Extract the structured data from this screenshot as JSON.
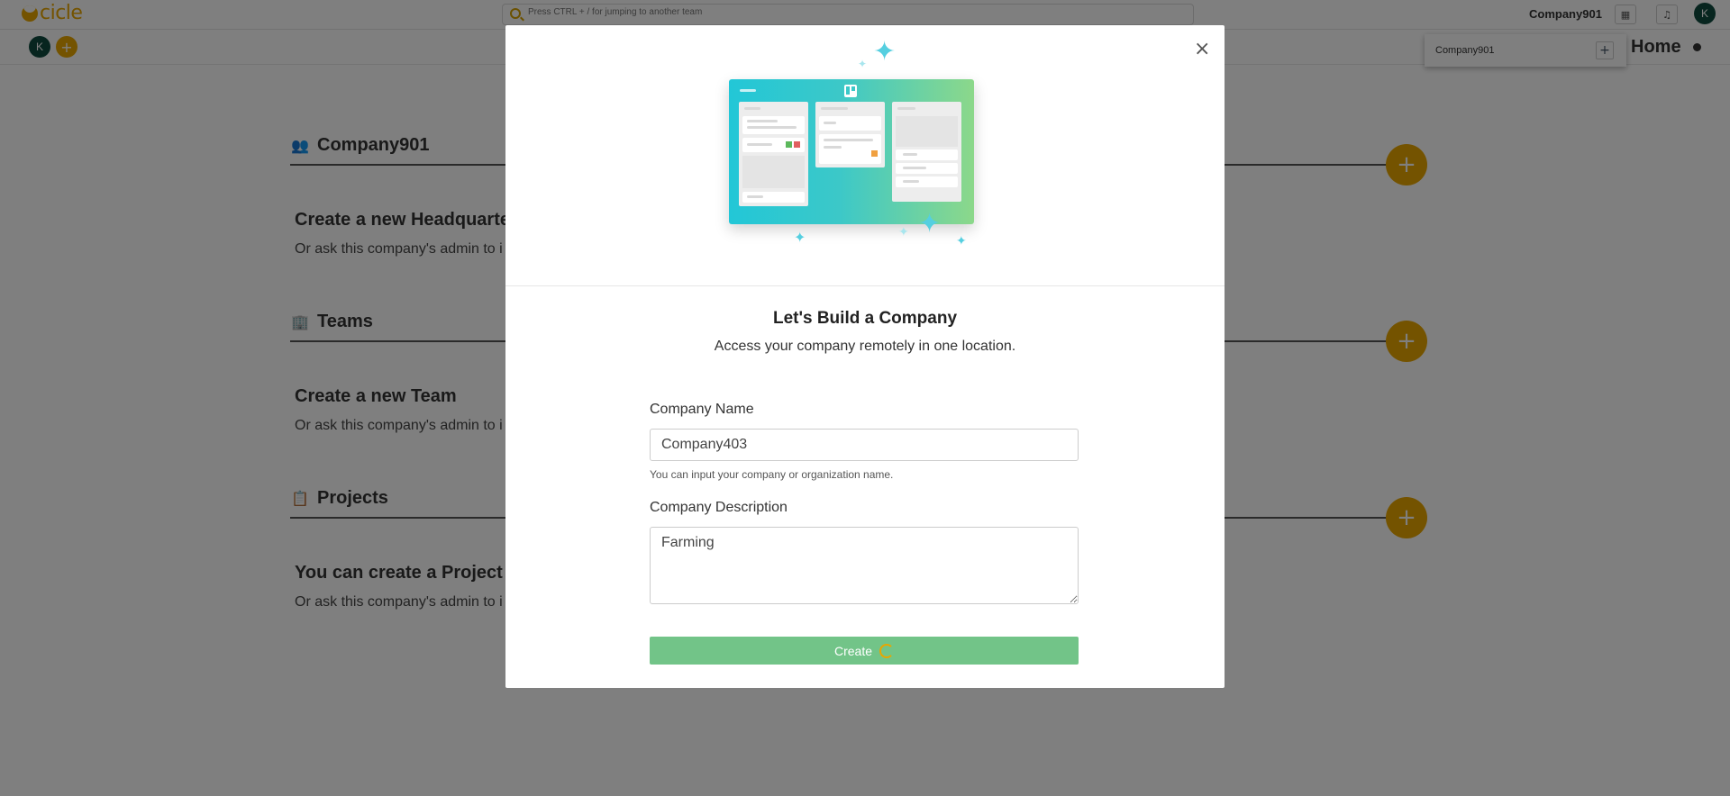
{
  "app": {
    "logo_text": "cicle",
    "company": "Company901",
    "avatar_initial": "K"
  },
  "search": {
    "placeholder": "Press CTRL + / for jumping to another team"
  },
  "header": {
    "title": "Home"
  },
  "dropdown": {
    "item": "Company901"
  },
  "sections": [
    {
      "title": "Company901",
      "heading": "Create a new Headquarter",
      "sub": "Or ask this company's admin to i"
    },
    {
      "title": "Teams",
      "heading": "Create a new Team",
      "sub": "Or ask this company's admin to i"
    },
    {
      "title": "Projects",
      "heading": "You can create a Project to",
      "sub": "Or ask this company's admin to i"
    }
  ],
  "modal": {
    "title": "Let's Build a Company",
    "subtitle": "Access your company remotely in one location.",
    "name_label": "Company Name",
    "name_value": "Company403",
    "name_help": "You can input your company or organization name.",
    "desc_label": "Company Description",
    "desc_value": "Farming",
    "create_label": "Create",
    "close_glyph": "×"
  },
  "colors": {
    "accent": "#e8a600",
    "create_button": "#72c488",
    "avatar": "#0f4a3e"
  },
  "icons": [
    "search-icon",
    "home-icon",
    "bell-icon",
    "plus-icon",
    "users-icon",
    "building-icon",
    "clipboard-icon",
    "close-icon",
    "trello-icon",
    "sparkle-icon",
    "spinner-icon"
  ]
}
